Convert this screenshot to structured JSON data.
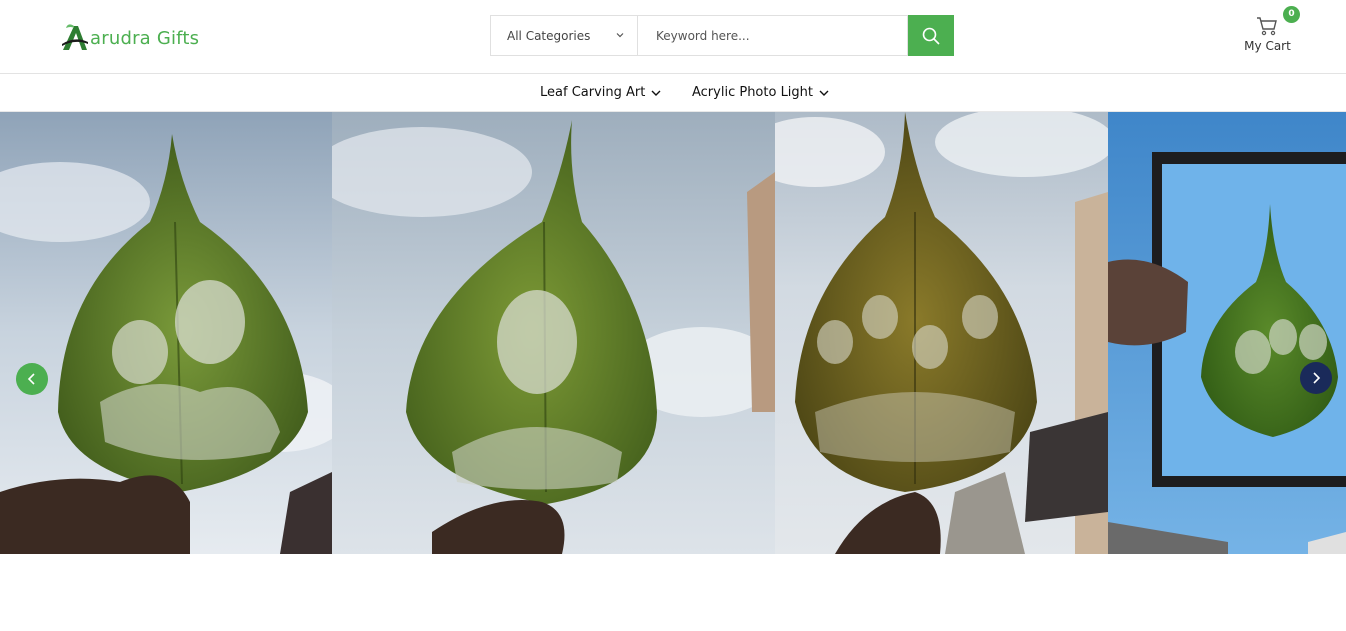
{
  "brand": {
    "logo_letter": "A",
    "name": "arudra Gifts",
    "color": "#4caf50"
  },
  "search": {
    "category_selected": "All Categories",
    "keyword_placeholder": "Keyword here...",
    "keyword_value": "",
    "button_icon": "search-icon"
  },
  "cart": {
    "label": "My Cart",
    "count": "0",
    "icon": "cart-icon"
  },
  "nav": {
    "items": [
      {
        "label": "Leaf Carving Art",
        "icon": "chevron-down-icon"
      },
      {
        "label": "Acrylic Photo Light",
        "icon": "chevron-down-icon"
      }
    ]
  },
  "slider": {
    "slides": [
      {
        "subject": "leaf carving portrait of mother and child"
      },
      {
        "subject": "leaf carving portrait of young man"
      },
      {
        "subject": "leaf carving portrait of group of four"
      },
      {
        "subject": "leaf carving portrait of family in acrylic frame"
      }
    ],
    "prev_icon": "chevron-left-icon",
    "next_icon": "chevron-right-icon"
  },
  "colors": {
    "accent": "#4caf50",
    "next_arrow": "#1a2a5a",
    "sky": "#c9d6e3",
    "leaf": "#5a7a2a"
  }
}
